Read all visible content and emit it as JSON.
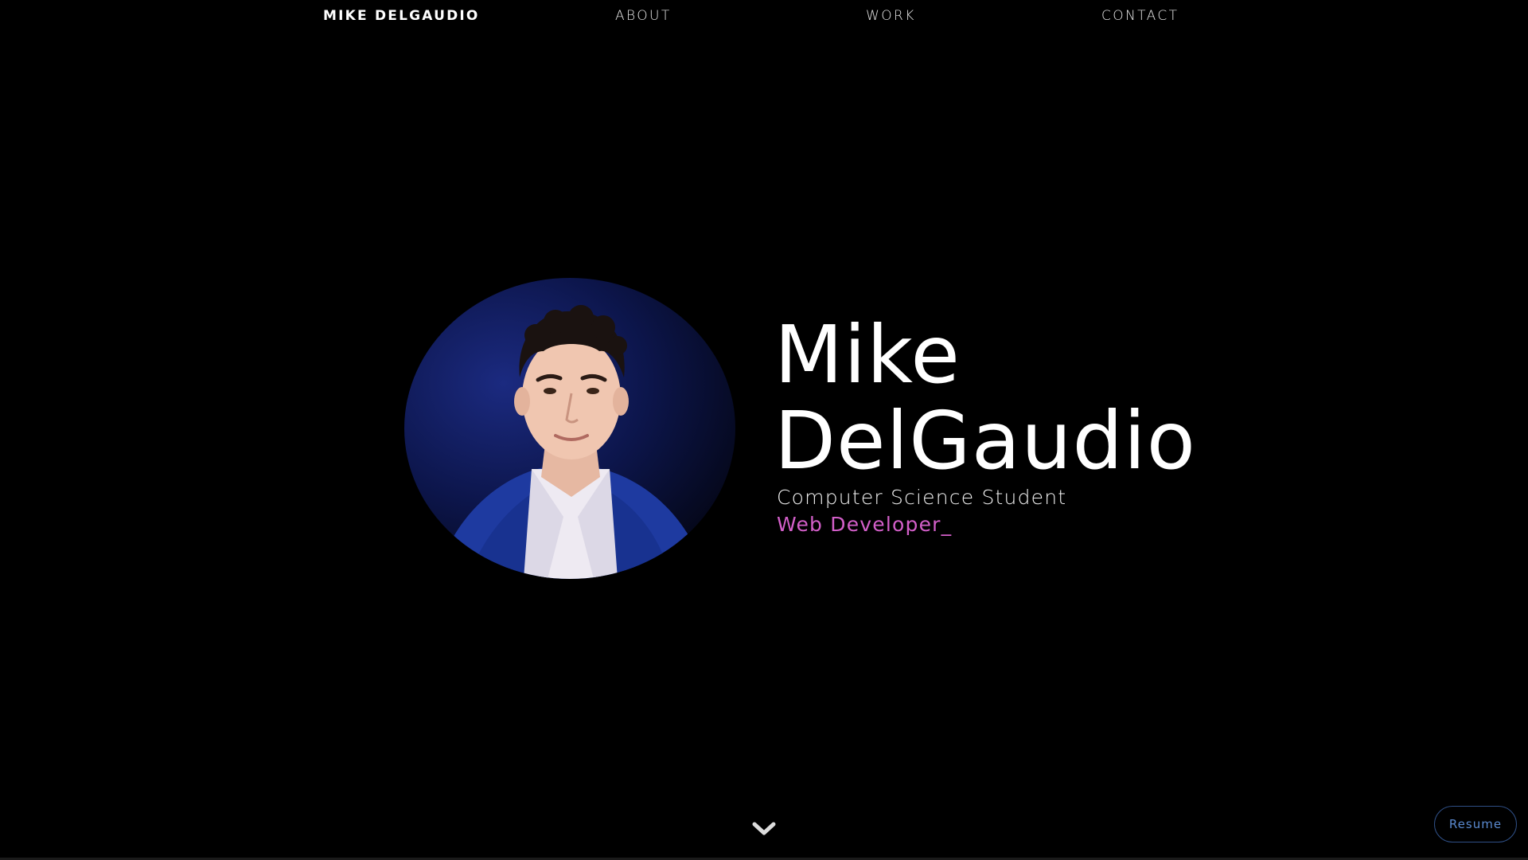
{
  "nav": {
    "brand": "MIKE DELGAUDIO",
    "items": [
      {
        "label": "ABOUT"
      },
      {
        "label": "WORK"
      },
      {
        "label": "CONTACT"
      }
    ]
  },
  "hero": {
    "first_name": "Mike",
    "last_name": "DelGaudio",
    "subtitle": "Computer Science Student",
    "typed_text": "Web Developer_"
  },
  "resume_button": {
    "label": "Resume"
  },
  "colors": {
    "background": "#000000",
    "accent_pink": "#d35fc9",
    "button_border": "#2f4f86",
    "button_text": "#5a8ad0"
  },
  "icons": {
    "scroll": "chevron-down-icon"
  }
}
